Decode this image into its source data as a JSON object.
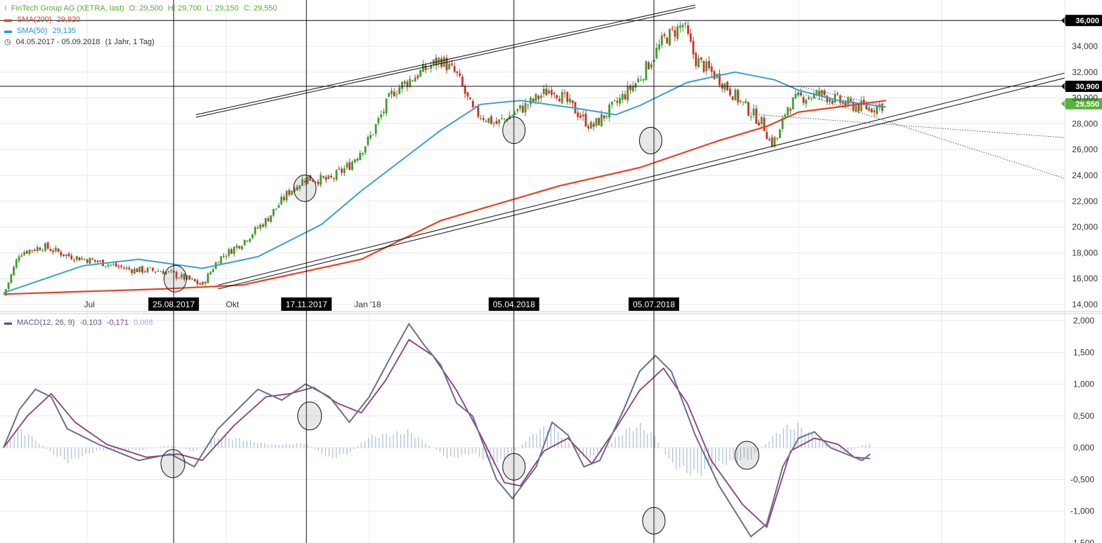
{
  "header": {
    "symbol": "FinTech Group AG (XETRA, last)",
    "open": "O: 29,500",
    "high": "H: 29,700",
    "low": "L: 29,150",
    "close": "C: 29,550",
    "sma200_label": "SMA(200)",
    "sma200_value": "29,820",
    "sma50_label": "SMA(50)",
    "sma50_value": "29,135",
    "date_range": "04.05.2017 - 05.09.2018",
    "interval": "(1 Jahr, 1 Tag)"
  },
  "macd_header": {
    "label": "MACD(12, 26, 9)",
    "macd": "-0,103",
    "signal": "-0,171",
    "histogram": "0,068"
  },
  "colors": {
    "candle_up": "#3c9c2e",
    "candle_down": "#c8322a",
    "sma200": "#e8401f",
    "sma50": "#3aa0cc",
    "macd": "#6a6e8e",
    "signal": "#8a3d7a",
    "histogram": "#a9bdd8",
    "grid": "#e8e8e8",
    "label_bg": "#000000",
    "last_price_bg": "#57b33b"
  },
  "chart_data": [
    {
      "type": "candlestick",
      "title": "FinTech Group AG (XETRA, last)",
      "x_range": [
        "04.05.2017",
        "05.09.2018"
      ],
      "x_tick_labels": [
        "Jul",
        "Okt",
        "Jan '18"
      ],
      "marked_dates": [
        "25.08.2017",
        "17.11.2017",
        "05.04.2018",
        "05.07.2018"
      ],
      "ylim": [
        14000,
        36500
      ],
      "y_ticks": [
        14000,
        16000,
        18000,
        20000,
        22000,
        24000,
        26000,
        28000,
        30000,
        32000,
        34000,
        36000
      ],
      "y_tick_labels": [
        "14,000",
        "16,000",
        "18,000",
        "20,000",
        "22,000",
        "24,000",
        "26,000",
        "28,000",
        "30,000",
        "32,000",
        "34,000"
      ],
      "price_levels": [
        {
          "value": 36000,
          "label": "36,000"
        },
        {
          "value": 30900,
          "label": "30,900"
        },
        {
          "value": 29550,
          "label": "29,550"
        }
      ],
      "price_path": [
        [
          0,
          14700
        ],
        [
          0.02,
          18000
        ],
        [
          0.05,
          18500
        ],
        [
          0.08,
          17800
        ],
        [
          0.12,
          17300
        ],
        [
          0.16,
          16700
        ],
        [
          0.2,
          16600
        ],
        [
          0.23,
          16000
        ],
        [
          0.25,
          15500
        ],
        [
          0.27,
          17500
        ],
        [
          0.3,
          18800
        ],
        [
          0.33,
          20500
        ],
        [
          0.36,
          22800
        ],
        [
          0.38,
          23800
        ],
        [
          0.41,
          23600
        ],
        [
          0.435,
          24800
        ],
        [
          0.46,
          26800
        ],
        [
          0.49,
          30500
        ],
        [
          0.52,
          31800
        ],
        [
          0.55,
          33000
        ],
        [
          0.57,
          31800
        ],
        [
          0.59,
          29000
        ],
        [
          0.62,
          28000
        ],
        [
          0.66,
          29500
        ],
        [
          0.69,
          30800
        ],
        [
          0.72,
          29000
        ],
        [
          0.74,
          27700
        ],
        [
          0.77,
          29500
        ],
        [
          0.8,
          31500
        ],
        [
          0.83,
          34500
        ],
        [
          0.855,
          35700
        ],
        [
          0.87,
          33000
        ],
        [
          0.9,
          31500
        ],
        [
          0.93,
          29500
        ],
        [
          0.955,
          28000
        ],
        [
          0.965,
          26500
        ],
        [
          0.975,
          27000
        ],
        [
          0.985,
          29300
        ],
        [
          1.0,
          30000
        ],
        [
          1.03,
          30300
        ],
        [
          1.06,
          29500
        ],
        [
          1.09,
          29200
        ],
        [
          1.11,
          29550
        ]
      ],
      "sma200": [
        [
          0,
          14800
        ],
        [
          0.2,
          15200
        ],
        [
          0.3,
          15500
        ],
        [
          0.45,
          17500
        ],
        [
          0.55,
          20500
        ],
        [
          0.7,
          23200
        ],
        [
          0.8,
          24600
        ],
        [
          0.9,
          26700
        ],
        [
          0.96,
          27800
        ],
        [
          1.0,
          28900
        ],
        [
          1.05,
          29300
        ],
        [
          1.11,
          29800
        ]
      ],
      "sma50": [
        [
          0,
          14900
        ],
        [
          0.1,
          17000
        ],
        [
          0.17,
          17500
        ],
        [
          0.25,
          16800
        ],
        [
          0.32,
          17700
        ],
        [
          0.4,
          20200
        ],
        [
          0.45,
          22800
        ],
        [
          0.55,
          27500
        ],
        [
          0.6,
          29500
        ],
        [
          0.65,
          29800
        ],
        [
          0.72,
          29200
        ],
        [
          0.77,
          28700
        ],
        [
          0.8,
          29400
        ],
        [
          0.86,
          31200
        ],
        [
          0.92,
          32000
        ],
        [
          0.97,
          31400
        ],
        [
          1.0,
          30600
        ],
        [
          1.05,
          29800
        ],
        [
          1.11,
          29300
        ]
      ],
      "trendlines": [
        {
          "style": "solid",
          "from": [
            0.242,
            28500
          ],
          "to": [
            0.87,
            37000
          ]
        },
        {
          "style": "solid",
          "from": [
            0.242,
            28700
          ],
          "to": [
            0.87,
            37200
          ]
        },
        {
          "style": "solid",
          "from": [
            0.27,
            15200
          ],
          "to": [
            1.56,
            35000
          ]
        },
        {
          "style": "solid",
          "from": [
            0.27,
            15500
          ],
          "to": [
            1.56,
            35400
          ]
        },
        {
          "style": "dotted",
          "from": [
            0.95,
            28700
          ],
          "to": [
            1.6,
            25700
          ]
        },
        {
          "style": "dotted",
          "from": [
            1.0,
            30400
          ],
          "to": [
            1.6,
            18500
          ]
        },
        {
          "style": "dotted",
          "from": [
            1.0,
            30900
          ],
          "to": [
            1.1,
            29500
          ]
        }
      ]
    },
    {
      "type": "line",
      "title": "MACD(12, 26, 9)",
      "ylim": [
        -1.5,
        2.1
      ],
      "y_ticks": [
        -1.5,
        -1.0,
        -0.5,
        0,
        0.5,
        1.0,
        1.5,
        2.0
      ],
      "y_tick_labels": [
        "-1,500",
        "-1,000",
        "-0,500",
        "0,000",
        "0,500",
        "1,000",
        "1,500",
        "2,000"
      ],
      "macd": [
        [
          0,
          0
        ],
        [
          0.02,
          0.6
        ],
        [
          0.04,
          0.92
        ],
        [
          0.06,
          0.8
        ],
        [
          0.08,
          0.3
        ],
        [
          0.12,
          0.05
        ],
        [
          0.17,
          -0.2
        ],
        [
          0.21,
          -0.1
        ],
        [
          0.24,
          -0.3
        ],
        [
          0.27,
          0.3
        ],
        [
          0.32,
          0.92
        ],
        [
          0.35,
          0.75
        ],
        [
          0.38,
          1.0
        ],
        [
          0.41,
          0.8
        ],
        [
          0.435,
          0.4
        ],
        [
          0.46,
          0.8
        ],
        [
          0.49,
          1.5
        ],
        [
          0.51,
          1.95
        ],
        [
          0.53,
          1.6
        ],
        [
          0.55,
          1.3
        ],
        [
          0.57,
          0.7
        ],
        [
          0.59,
          0.5
        ],
        [
          0.62,
          -0.5
        ],
        [
          0.64,
          -0.8
        ],
        [
          0.67,
          -0.3
        ],
        [
          0.69,
          0.4
        ],
        [
          0.71,
          0.2
        ],
        [
          0.73,
          -0.3
        ],
        [
          0.75,
          -0.2
        ],
        [
          0.78,
          0.6
        ],
        [
          0.8,
          1.2
        ],
        [
          0.82,
          1.45
        ],
        [
          0.84,
          1.2
        ],
        [
          0.87,
          0.2
        ],
        [
          0.9,
          -0.6
        ],
        [
          0.94,
          -1.4
        ],
        [
          0.96,
          -1.2
        ],
        [
          0.98,
          -0.3
        ],
        [
          1.0,
          0.15
        ],
        [
          1.02,
          0.25
        ],
        [
          1.04,
          0.0
        ],
        [
          1.06,
          -0.1
        ],
        [
          1.08,
          -0.2
        ],
        [
          1.09,
          -0.1
        ]
      ],
      "signal": [
        [
          0,
          0
        ],
        [
          0.03,
          0.5
        ],
        [
          0.06,
          0.85
        ],
        [
          0.09,
          0.4
        ],
        [
          0.13,
          0.05
        ],
        [
          0.18,
          -0.15
        ],
        [
          0.22,
          -0.1
        ],
        [
          0.25,
          -0.2
        ],
        [
          0.29,
          0.35
        ],
        [
          0.33,
          0.8
        ],
        [
          0.36,
          0.85
        ],
        [
          0.39,
          0.95
        ],
        [
          0.42,
          0.7
        ],
        [
          0.45,
          0.55
        ],
        [
          0.48,
          1.05
        ],
        [
          0.51,
          1.7
        ],
        [
          0.54,
          1.45
        ],
        [
          0.57,
          0.9
        ],
        [
          0.6,
          0.2
        ],
        [
          0.63,
          -0.55
        ],
        [
          0.65,
          -0.6
        ],
        [
          0.68,
          -0.05
        ],
        [
          0.71,
          0.15
        ],
        [
          0.74,
          -0.25
        ],
        [
          0.77,
          0.3
        ],
        [
          0.8,
          0.9
        ],
        [
          0.83,
          1.25
        ],
        [
          0.86,
          0.7
        ],
        [
          0.89,
          -0.2
        ],
        [
          0.93,
          -0.9
        ],
        [
          0.96,
          -1.25
        ],
        [
          0.99,
          -0.05
        ],
        [
          1.02,
          0.15
        ],
        [
          1.05,
          0.05
        ],
        [
          1.07,
          -0.15
        ],
        [
          1.09,
          -0.17
        ]
      ],
      "histogram_envelope": [
        [
          0,
          0
        ],
        [
          0.02,
          0.35
        ],
        [
          0.04,
          0.15
        ],
        [
          0.06,
          -0.1
        ],
        [
          0.08,
          -0.25
        ],
        [
          0.12,
          -0.05
        ],
        [
          0.17,
          -0.05
        ],
        [
          0.21,
          0.05
        ],
        [
          0.24,
          -0.08
        ],
        [
          0.27,
          0.2
        ],
        [
          0.3,
          0.15
        ],
        [
          0.34,
          0.05
        ],
        [
          0.38,
          0.08
        ],
        [
          0.41,
          -0.2
        ],
        [
          0.435,
          -0.1
        ],
        [
          0.46,
          0.2
        ],
        [
          0.49,
          0.25
        ],
        [
          0.51,
          0.3
        ],
        [
          0.53,
          0.1
        ],
        [
          0.56,
          -0.2
        ],
        [
          0.59,
          -0.1
        ],
        [
          0.62,
          -0.3
        ],
        [
          0.64,
          -0.1
        ],
        [
          0.67,
          0.3
        ],
        [
          0.69,
          0.4
        ],
        [
          0.71,
          0.1
        ],
        [
          0.73,
          -0.2
        ],
        [
          0.75,
          -0.1
        ],
        [
          0.78,
          0.3
        ],
        [
          0.8,
          0.4
        ],
        [
          0.82,
          0.2
        ],
        [
          0.84,
          -0.3
        ],
        [
          0.87,
          -0.5
        ],
        [
          0.9,
          -0.3
        ],
        [
          0.94,
          -0.2
        ],
        [
          0.96,
          0.1
        ],
        [
          0.98,
          0.35
        ],
        [
          1.0,
          0.4
        ],
        [
          1.02,
          0.2
        ],
        [
          1.04,
          0.05
        ],
        [
          1.06,
          -0.1
        ],
        [
          1.08,
          0.05
        ],
        [
          1.09,
          0.07
        ]
      ]
    }
  ]
}
